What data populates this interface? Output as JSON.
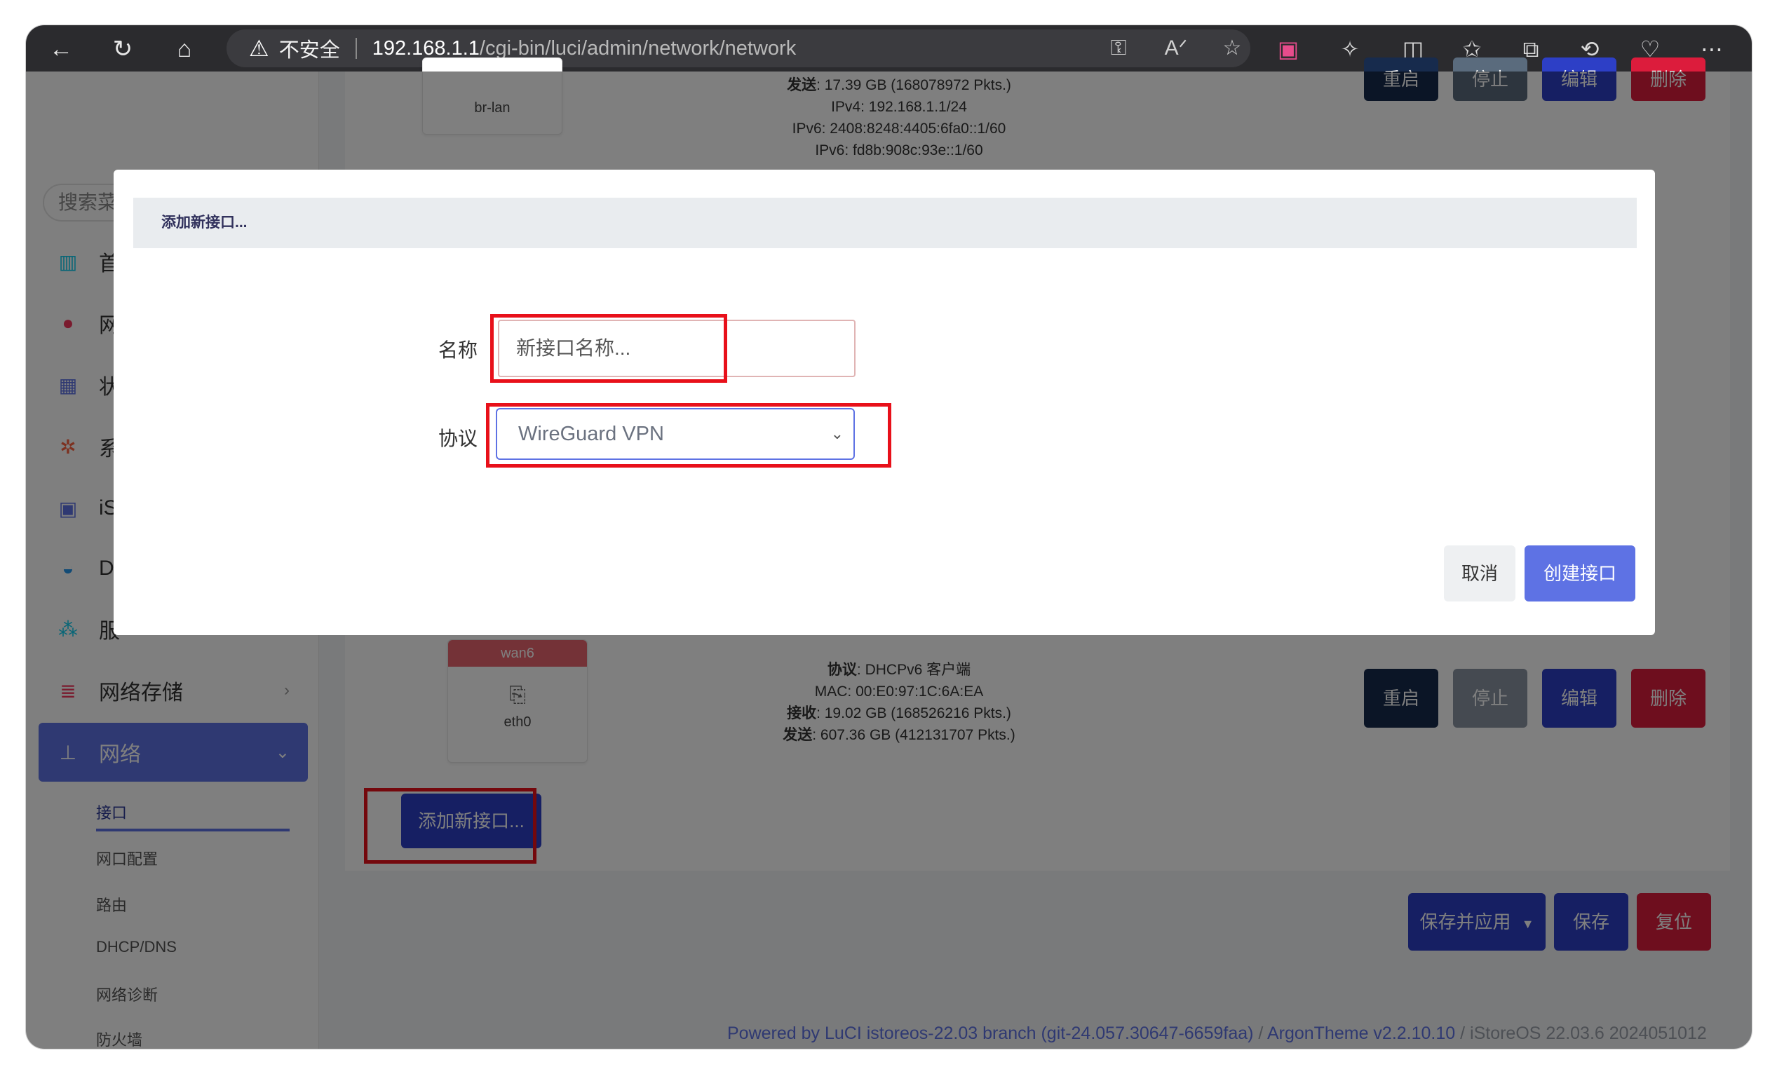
{
  "browser": {
    "insecure_label": "不安全",
    "url_host": "192.168.1.1",
    "url_path": "/cgi-bin/luci/admin/network/network"
  },
  "sidebar": {
    "search_placeholder": "搜索菜",
    "items": [
      {
        "label": "首",
        "icon": "dashboard-icon"
      },
      {
        "label": "网",
        "icon": "globe-icon"
      },
      {
        "label": "状",
        "icon": "grid-icon"
      },
      {
        "label": "系",
        "icon": "gear-icon"
      },
      {
        "label": "iS",
        "icon": "store-icon"
      },
      {
        "label": "Do",
        "icon": "docker-icon"
      },
      {
        "label": "服",
        "icon": "services-icon"
      },
      {
        "label": "网络存储",
        "icon": "storage-icon"
      },
      {
        "label": "网络",
        "icon": "network-icon"
      }
    ],
    "sub_items": [
      "接口",
      "网口配置",
      "路由",
      "DHCP/DNS",
      "网络诊断",
      "防火墙"
    ]
  },
  "interfaces": [
    {
      "name_label": "br-lan",
      "info": [
        {
          "k": "发送",
          "v": ": 17.39 GB (168078972 Pkts.)"
        },
        {
          "k": "",
          "v": "IPv4: 192.168.1.1/24"
        },
        {
          "k": "",
          "v": "IPv6: 2408:8248:4405:6fa0::1/60"
        },
        {
          "k": "",
          "v": "IPv6: fd8b:908c:93e::1/60"
        }
      ]
    },
    {
      "title": "wan6",
      "name_label": "eth0",
      "info": [
        {
          "k": "协议",
          "v": ": DHCPv6 客户端"
        },
        {
          "k": "",
          "v": "MAC: 00:E0:97:1C:6A:EA"
        },
        {
          "k": "接收",
          "v": ": 19.02 GB (168526216 Pkts.)"
        },
        {
          "k": "发送",
          "v": ": 607.36 GB (412131707 Pkts.)"
        }
      ]
    }
  ],
  "row_buttons": {
    "restart": "重启",
    "stop": "停止",
    "edit": "编辑",
    "delete": "删除"
  },
  "add_interface_button": "添加新接口...",
  "page_buttons": {
    "save_apply": "保存并应用",
    "save": "保存",
    "reset": "复位"
  },
  "footer": {
    "powered": "Powered by LuCI istoreos-22.03 branch (git-24.057.30647-6659faa)",
    "sep1": " / ",
    "theme": "ArgonTheme v2.2.10.10",
    "sep2": " / iStoreOS 22.03.6 2024051012"
  },
  "modal": {
    "title": "添加新接口...",
    "name_label": "名称",
    "name_placeholder": "新接口名称...",
    "protocol_label": "协议",
    "protocol_value": "WireGuard VPN",
    "cancel": "取消",
    "create": "创建接口"
  },
  "colors": {
    "accent": "#5e72e4",
    "danger": "#f5365c",
    "highlight": "#e8101a",
    "dark": "#172b4d"
  }
}
